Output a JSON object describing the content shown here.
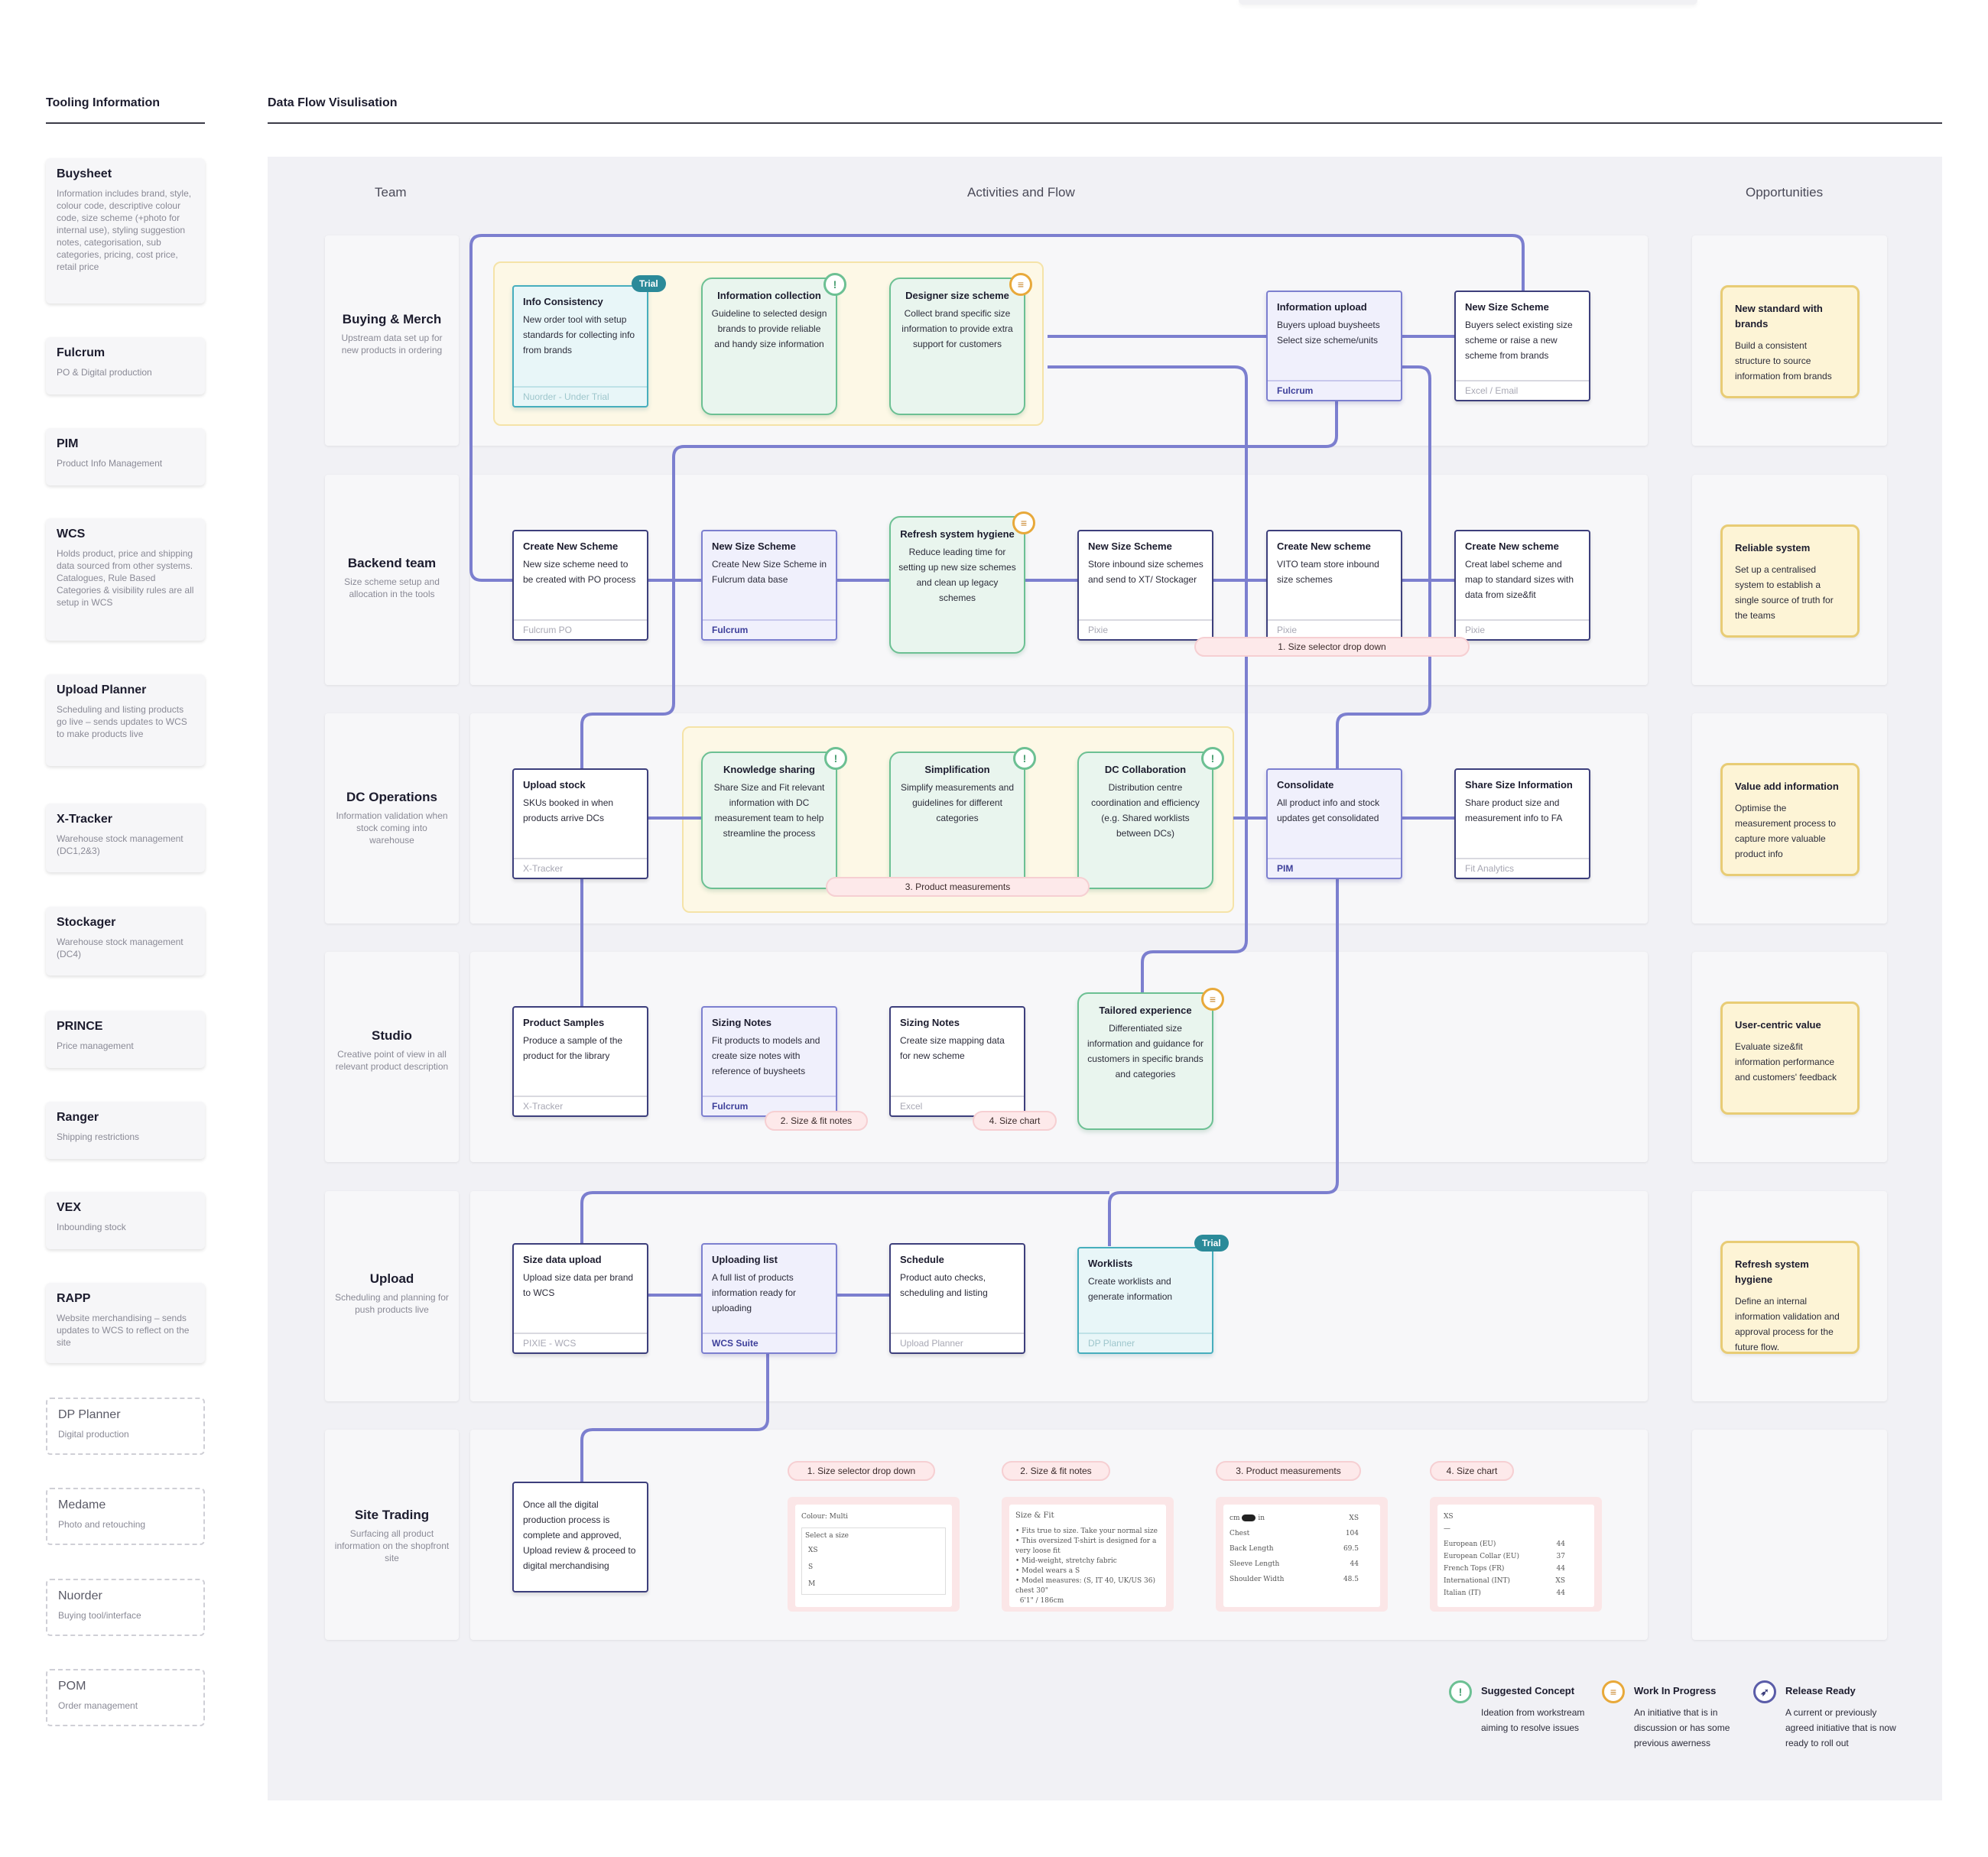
{
  "headers": {
    "tooling": "Tooling Information",
    "dataflow": "Data Flow Visulisation"
  },
  "columns": {
    "team": "Team",
    "activities": "Activities and Flow",
    "opportunities": "Opportunities"
  },
  "tools": [
    {
      "name": "Buysheet",
      "desc": "Information includes brand, style, colour code, descriptive colour code, size scheme (+photo for internal use), styling suggestion notes, categorisation, sub categories, pricing, cost price, retail price"
    },
    {
      "name": "Fulcrum",
      "desc": "PO & Digital production"
    },
    {
      "name": "PIM",
      "desc": "Product Info Management"
    },
    {
      "name": "WCS",
      "desc": "Holds product, price and shipping data sourced from other systems. Catalogues, Rule Based Categories & visibility rules are all setup in WCS"
    },
    {
      "name": "Upload Planner",
      "desc": "Scheduling and listing products go live – sends updates to WCS to make products live"
    },
    {
      "name": "X-Tracker",
      "desc": "Warehouse stock management (DC1,2&3)"
    },
    {
      "name": "Stockager",
      "desc": "Warehouse stock management (DC4)"
    },
    {
      "name": "PRINCE",
      "desc": "Price management"
    },
    {
      "name": "Ranger",
      "desc": "Shipping restrictions"
    },
    {
      "name": "VEX",
      "desc": "Inbounding stock"
    },
    {
      "name": "RAPP",
      "desc": "Website merchandising – sends updates to WCS to reflect on the site"
    },
    {
      "name": "DP Planner",
      "desc": "Digital production"
    },
    {
      "name": "Medame",
      "desc": "Photo and retouching"
    },
    {
      "name": "Nuorder",
      "desc": "Buying tool/interface"
    },
    {
      "name": "POM",
      "desc": "Order management"
    }
  ],
  "teams": [
    {
      "title": "Buying & Merch",
      "desc": "Upstream data set up for new products in ordering"
    },
    {
      "title": "Backend team",
      "desc": "Size scheme setup and allocation in the tools"
    },
    {
      "title": "DC Operations",
      "desc": "Information validation when stock coming into warehouse"
    },
    {
      "title": "Studio",
      "desc": "Creative point of view in all relevant product description"
    },
    {
      "title": "Upload",
      "desc": "Scheduling and planning for push products live"
    },
    {
      "title": "Site Trading",
      "desc": "Surfacing all product information on the shopfront site"
    }
  ],
  "nodes": {
    "info_consistency": {
      "title": "Info Consistency",
      "desc": "New order tool with setup standards for collecting info from brands",
      "foot": "Nuorder - Under Trial",
      "badge": "Trial"
    },
    "info_collection": {
      "title": "Information collection",
      "desc": "Guideline to selected design brands to provide reliable and handy size information"
    },
    "designer_size": {
      "title": "Designer size scheme",
      "desc": "Collect brand specific size information to provide extra support for customers"
    },
    "info_upload": {
      "title": "Information upload",
      "desc": "Buyers upload buysheets Select size scheme/units",
      "foot": "Fulcrum"
    },
    "new_size_scheme_bm": {
      "title": "New Size Scheme",
      "desc": "Buyers select existing size scheme or raise a new scheme from brands",
      "foot": "Excel / Email"
    },
    "create_new_scheme_1": {
      "title": "Create New Scheme",
      "desc": "New size scheme need to be created with PO process",
      "foot": "Fulcrum PO"
    },
    "new_size_scheme_fulcrum": {
      "title": "New Size Scheme",
      "desc": "Create New Size Scheme in Fulcrum data base",
      "foot": "Fulcrum"
    },
    "refresh_hygiene": {
      "title": "Refresh system hygiene",
      "desc": "Reduce leading time for setting up new size schemes and clean up legacy schemes"
    },
    "new_size_scheme_pixie": {
      "title": "New Size Scheme",
      "desc": "Store inbound size schemes and send to XT/ Stockager",
      "foot": "Pixie"
    },
    "create_new_scheme_vito": {
      "title": "Create New scheme",
      "desc": "VITO team store inbound size schemes",
      "foot": "Pixie"
    },
    "create_new_scheme_label": {
      "title": "Create New scheme",
      "desc": "Creat label scheme and map to standard sizes with data from size&fit",
      "foot": "Pixie"
    },
    "upload_stock": {
      "title": "Upload stock",
      "desc": "SKUs booked in when products arrive DCs",
      "foot": "X-Tracker"
    },
    "knowledge_sharing": {
      "title": "Knowledge sharing",
      "desc": "Share Size and Fit relevant information with DC measurement team to help streamline the process"
    },
    "simplification": {
      "title": "Simplification",
      "desc": "Simplify measurements and guidelines for different categories"
    },
    "dc_collab": {
      "title": "DC Collaboration",
      "desc": "Distribution centre coordination and efficiency (e.g. Shared worklists between DCs)"
    },
    "consolidate": {
      "title": "Consolidate",
      "desc": "All product info and stock updates get consolidated",
      "foot": "PIM"
    },
    "share_size_info": {
      "title": "Share Size Information",
      "desc": "Share product size and measurement info to FA",
      "foot": "Fit Analytics"
    },
    "product_samples": {
      "title": "Product Samples",
      "desc": "Produce a sample of the product for the library",
      "foot": "X-Tracker"
    },
    "sizing_notes_fulcrum": {
      "title": "Sizing Notes",
      "desc": "Fit products to models and create size notes with reference of buysheets",
      "foot": "Fulcrum"
    },
    "sizing_notes_excel": {
      "title": "Sizing Notes",
      "desc": "Create size mapping data for new scheme",
      "foot": "Excel"
    },
    "tailored_experience": {
      "title": "Tailored experience",
      "desc": "Differentiated size information and guidance for customers in specific brands and categories"
    },
    "size_data_upload": {
      "title": "Size data upload",
      "desc": "Upload size data per brand to WCS",
      "foot": "PIXIE - WCS"
    },
    "uploading_list": {
      "title": "Uploading list",
      "desc": "A full list of products information ready for uploading",
      "foot": "WCS Suite"
    },
    "schedule": {
      "title": "Schedule",
      "desc": "Product auto checks, scheduling and listing",
      "foot": "Upload Planner"
    },
    "worklists": {
      "title": "Worklists",
      "desc": "Create worklists and generate information",
      "foot": "DP Planner",
      "badge": "Trial"
    },
    "site_trading": {
      "desc": "Once all the digital production process is complete and approved, Upload review & proceed to digital merchandising"
    }
  },
  "pills": {
    "size_selector": "1.  Size selector drop down",
    "size_fit_notes": "2.  Size & fit notes",
    "product_measurements": "3.  Product measurements",
    "size_chart": "4.  Size chart"
  },
  "thumbs": {
    "t1": {
      "line1": "Colour: Multi",
      "line2": "Select a size",
      "opts": [
        "XS",
        "S",
        "M"
      ]
    },
    "t2": {
      "head": "Size & Fit",
      "bullets": [
        "Fits true to size. Take your normal size",
        "This oversized T-shirt is designed for a very loose fit",
        "Mid-weight, stretchy fabric",
        "Model wears a S",
        "Model measures: (S, IT 40, UK/US 36) chest 30\"",
        "6'1\" / 186cm"
      ]
    },
    "t3": {
      "toggle_a": "cm",
      "toggle_b": "in",
      "col": "XS",
      "rows": [
        [
          "Chest",
          "104"
        ],
        [
          "Back Length",
          "69.5"
        ],
        [
          "Sleeve Length",
          "44"
        ],
        [
          "Shoulder Width",
          "48.5"
        ]
      ]
    },
    "t4": {
      "col": "XS",
      "rows": [
        [
          "European (EU)",
          "44"
        ],
        [
          "European Collar (EU)",
          "37"
        ],
        [
          "French Tops (FR)",
          "44"
        ],
        [
          "International (INT)",
          "XS"
        ],
        [
          "Italian (IT)",
          "44"
        ]
      ]
    }
  },
  "opportunities": [
    {
      "title": "New standard with brands",
      "desc": "Build a consistent structure to source information from brands"
    },
    {
      "title": "Reliable system",
      "desc": "Set up a centralised system to establish a single source of truth for the teams"
    },
    {
      "title": "Value add information",
      "desc": "Optimise the measurement process to capture more valuable product info"
    },
    {
      "title": "User-centric value",
      "desc": "Evaluate size&fit information performance and customers' feedback"
    },
    {
      "title": "Refresh system hygiene",
      "desc": "Define an internal information validation and approval process for the future flow."
    }
  ],
  "legend": [
    {
      "title": "Suggested Concept",
      "desc": "Ideation from workstream aiming to resolve issues",
      "icon": "lightbulb-icon"
    },
    {
      "title": "Work In Progress",
      "desc": "An initiative that is in discussion or has some previous awerness",
      "icon": "construction-icon"
    },
    {
      "title": "Release Ready",
      "desc": "A current or previously agreed initiative that is now ready to roll out",
      "icon": "rocket-icon"
    }
  ],
  "colors": {
    "line": "#7c7fcf",
    "accent_green": "#6cc093",
    "accent_yellow": "#e8cc75",
    "accent_teal": "#47aebd",
    "pill_pink": "#fde9ea"
  }
}
